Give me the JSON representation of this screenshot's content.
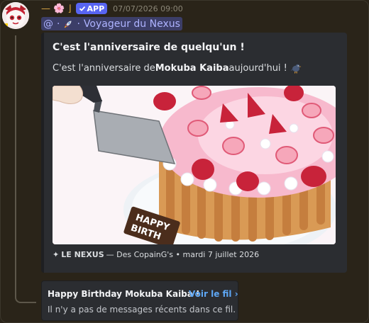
{
  "message": {
    "username": "— 🌸 ⌋",
    "app_badge": "APP",
    "timestamp": "07/07/2026 09:00",
    "role_line": {
      "at": "@",
      "sep1": "·",
      "sep2": "·",
      "server": "Voyageur du Nexus"
    }
  },
  "embed": {
    "title": "C'est l'anniversaire de quelqu'un !",
    "desc_prefix": "C'est l'anniversaire de ",
    "desc_name": "Mokuba Kaiba",
    "desc_suffix": " aujourd'hui !",
    "image": {
      "cake_plate_text_line1": "HAPPY",
      "cake_plate_text_line2": "BIRTH"
    },
    "footer": {
      "star": "✦",
      "brand": "LE NEXUS",
      "rest": "— Des CopainG's • mardi 7 juillet 2026"
    }
  },
  "thread": {
    "title": "Happy Birthday Mokuba Kaiba !",
    "link": "Voir le fil ›",
    "subtitle": "Il n'y a pas de messages récents dans ce fil."
  },
  "colors": {
    "background": "#2a2419",
    "embed_bg": "#2b2d31",
    "username": "#d6a545",
    "badge": "#5865f2",
    "link": "#5ea7f5"
  }
}
